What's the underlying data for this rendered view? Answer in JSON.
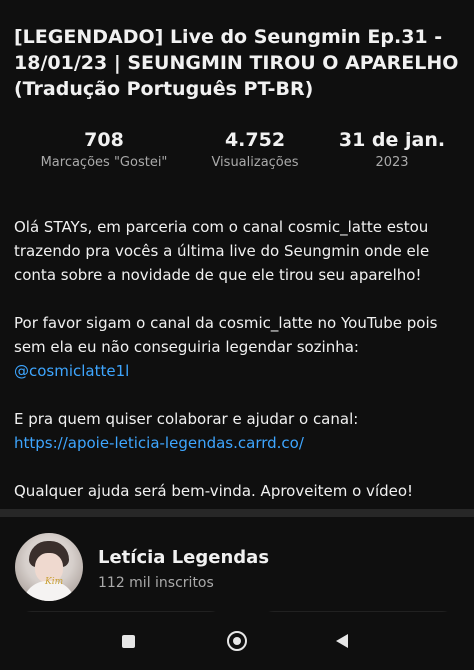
{
  "video": {
    "title": "[LEGENDADO] Live do Seungmin Ep.31 - 18/01/23 | SEUNGMIN TIROU O APARELHO (Tradução Português PT-BR)"
  },
  "stats": {
    "likes_value": "708",
    "likes_label": "Marcações \"Gostei\"",
    "views_value": "4.752",
    "views_label": "Visualizações",
    "date_value": "31 de jan.",
    "date_label": "2023"
  },
  "description": {
    "paragraph1": "Olá STAYs, em parceria com o canal cosmic_latte estou trazendo pra vocês a última live do Seungmin onde ele conta sobre a novidade de que ele tirou seu aparelho!",
    "paragraph2_text": "Por favor sigam o canal da cosmic_latte no YouTube pois sem ela eu não conseguiria legendar sozinha:",
    "paragraph2_link": "@cosmiclatte1l",
    "paragraph3_text": "E pra quem quiser colaborar e ajudar o canal:",
    "paragraph3_link": "https://apoie-leticia-legendas.carrd.co/",
    "paragraph4": "Qualquer ajuda será bem-vinda. Aproveitem o vídeo!"
  },
  "channel": {
    "name": "Letícia Legendas",
    "subscribers": "112 mil inscritos",
    "avatar_badge": "Kim"
  },
  "navbar": {
    "recents_icon": "square-icon",
    "home_icon": "circle-home-icon",
    "back_icon": "triangle-back-icon"
  },
  "colors": {
    "background": "#0f0f0f",
    "text_primary": "#f1f1f1",
    "text_secondary": "#aaaaaa",
    "link": "#3ea6ff",
    "divider": "#272727"
  }
}
